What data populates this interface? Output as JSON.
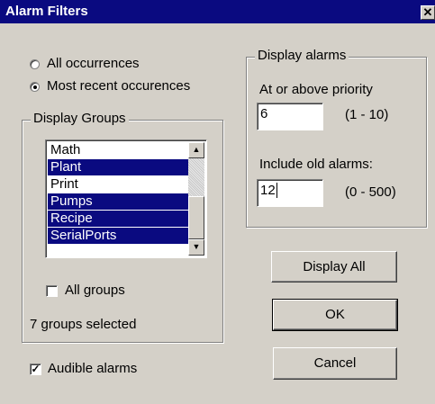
{
  "window": {
    "title": "Alarm Filters",
    "close_label": "✕"
  },
  "occurrence": {
    "options": [
      {
        "label": "All occurrences",
        "selected": false
      },
      {
        "label": "Most recent occurences",
        "selected": true
      }
    ]
  },
  "display_groups": {
    "title": "Display Groups",
    "items": [
      {
        "label": "Math",
        "selected": false
      },
      {
        "label": "Plant",
        "selected": true
      },
      {
        "label": "Print",
        "selected": false
      },
      {
        "label": "Pumps",
        "selected": true
      },
      {
        "label": "Recipe",
        "selected": true
      },
      {
        "label": "SerialPorts",
        "selected": true
      }
    ],
    "all_groups_label": "All groups",
    "all_groups_checked": false,
    "selected_count_text": "7 groups selected"
  },
  "display_alarms": {
    "title": "Display alarms",
    "priority_label": "At or above priority",
    "priority_value": "6",
    "priority_range": "(1 - 10)",
    "old_alarms_label": "Include old alarms:",
    "old_alarms_value": "12",
    "old_alarms_range": "(0 - 500)"
  },
  "buttons": {
    "display_all": "Display All",
    "ok": "OK",
    "cancel": "Cancel"
  },
  "audible_alarms": {
    "label": "Audible alarms",
    "checked": true
  }
}
